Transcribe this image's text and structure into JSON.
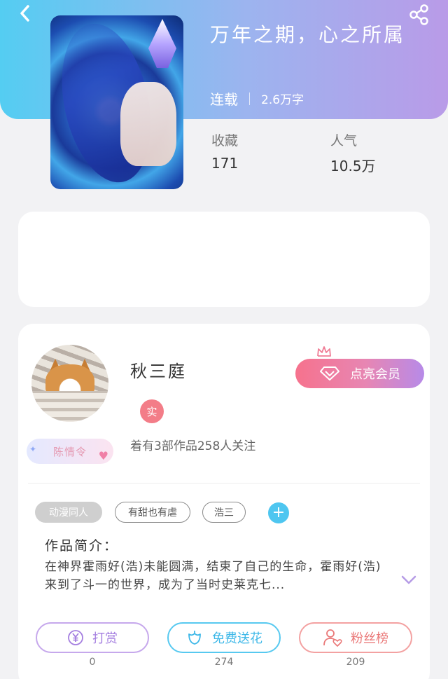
{
  "book": {
    "title": "万年之期，心之所属",
    "status": "连载",
    "word_count": "2.6万字"
  },
  "stats": {
    "favorites_label": "收藏",
    "favorites_value": "171",
    "popularity_label": "人气",
    "popularity_value": "10.5万"
  },
  "author": {
    "name": "秋三庭",
    "badge": "陈情令",
    "verified_mark": "实",
    "works_info": "着有3部作品258人关注",
    "vip_button": "点亮会员"
  },
  "tags": [
    "动漫同人",
    "有甜也有虐",
    "浩三"
  ],
  "intro": {
    "heading": "作品简介：",
    "text": "在神界霍雨好(浩)未能圆满，结束了自己的生命，霍雨好(浩)来到了斗一的世界，成为了当时史莱克七..."
  },
  "actions": [
    {
      "label": "打赏",
      "count": "0"
    },
    {
      "label": "免费送花",
      "count": "274"
    },
    {
      "label": "粉丝榜",
      "count": "209"
    }
  ],
  "colors": {
    "header_start": "#54cdf2",
    "header_end": "#b99be8",
    "tip_accent": "#a57fe0",
    "flower_accent": "#3eb8e8",
    "fans_accent": "#ea7878"
  },
  "icons": {
    "back": "chevron-left-icon",
    "share": "share-icon",
    "vip": "diamond-icon",
    "crown": "crown-icon",
    "tip": "yen-coin-icon",
    "flower": "flower-icon",
    "fans": "user-heart-icon",
    "expand": "chevron-down-icon"
  }
}
